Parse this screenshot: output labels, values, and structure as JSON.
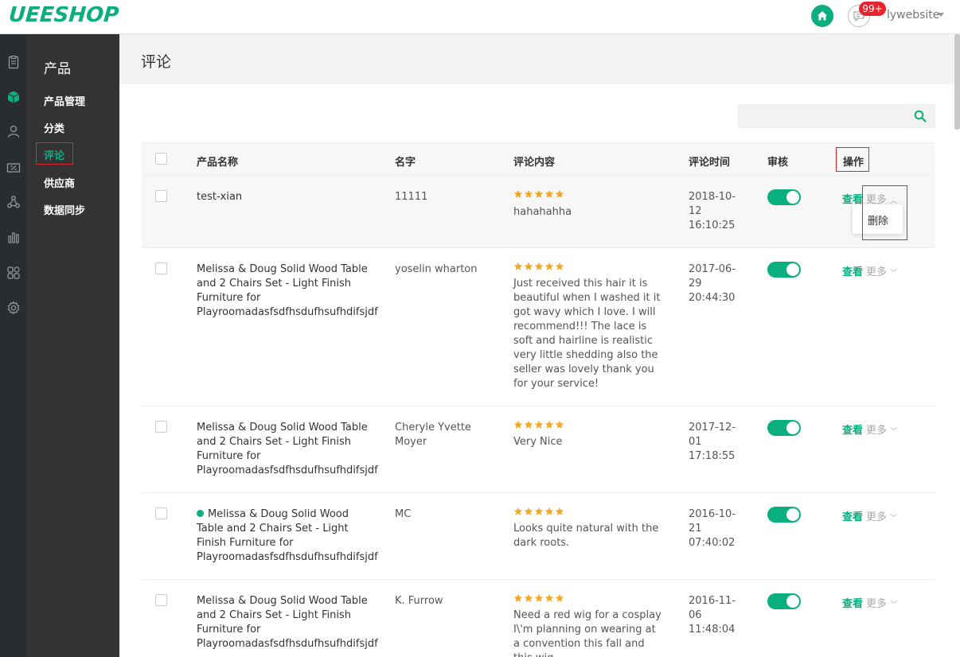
{
  "header": {
    "logo": "UEESHOP",
    "badge": "99+",
    "user": "lywebsite"
  },
  "sidebar": {
    "section_title": "产品",
    "items": [
      {
        "label": "产品管理"
      },
      {
        "label": "分类"
      },
      {
        "label": "评论"
      },
      {
        "label": "供应商"
      },
      {
        "label": "数据同步"
      }
    ],
    "rail_icons": [
      "clipboard-icon",
      "cube-icon",
      "user-icon",
      "coupon-icon",
      "network-icon",
      "bar-chart-icon",
      "apps-icon",
      "gear-icon"
    ]
  },
  "page": {
    "title": "评论",
    "search_placeholder": ""
  },
  "table": {
    "headers": {
      "product": "产品名称",
      "name": "名字",
      "content": "评论内容",
      "time": "评论时间",
      "audit": "审核",
      "actions": "操作"
    },
    "view_label": "查看",
    "more_label": "更多",
    "dropdown_delete": "删除",
    "rows": [
      {
        "product": "test-xian",
        "name": "11111",
        "rating": 5,
        "content": "hahahahha",
        "time_date": "2018-10-12",
        "time_clock": "16:10:25",
        "approved": true
      },
      {
        "product": "Melissa & Doug Solid Wood Table and 2 Chairs Set - Light Finish Furniture for Playroomadasfsdfhsdufhsufhdifsjdf",
        "name": "yoselin wharton",
        "rating": 5,
        "content": "Just received this hair it is beautiful when I washed it it got wavy which I love. I will recommend!!! The lace is soft and hairline is realistic very little shedding also the seller was lovely thank you for your service!",
        "time_date": "2017-06-29",
        "time_clock": "20:44:30",
        "approved": true
      },
      {
        "product": "Melissa & Doug Solid Wood Table and 2 Chairs Set - Light Finish Furniture for Playroomadasfsdfhsdufhsufhdifsjdf",
        "name": "Cheryle Yvette Moyer",
        "rating": 5,
        "content": "Very Nice",
        "time_date": "2017-12-01",
        "time_clock": "17:18:55",
        "approved": true
      },
      {
        "product": "Melissa & Doug Solid Wood Table and 2 Chairs Set - Light Finish Furniture for Playroomadasfsdfhsdufhsufhdifsjdf",
        "name": "MC",
        "rating": 5,
        "content": "Looks quite natural with the dark roots.",
        "time_date": "2016-10-21",
        "time_clock": "07:40:02",
        "approved": true
      },
      {
        "product": "Melissa & Doug Solid Wood Table and 2 Chairs Set - Light Finish Furniture for Playroomadasfsdfhsdufhsufhdifsjdf",
        "name": "K. Furrow",
        "rating": 5,
        "content": "Need a red wig for a cosplay I\\'m planning on wearing at a convention this fall and this wig",
        "time_date": "2016-11-06",
        "time_clock": "11:48:04",
        "approved": true
      }
    ]
  },
  "colors": {
    "brand": "#0baf7f",
    "highlight": "#e0242b",
    "star": "#f5a623"
  }
}
